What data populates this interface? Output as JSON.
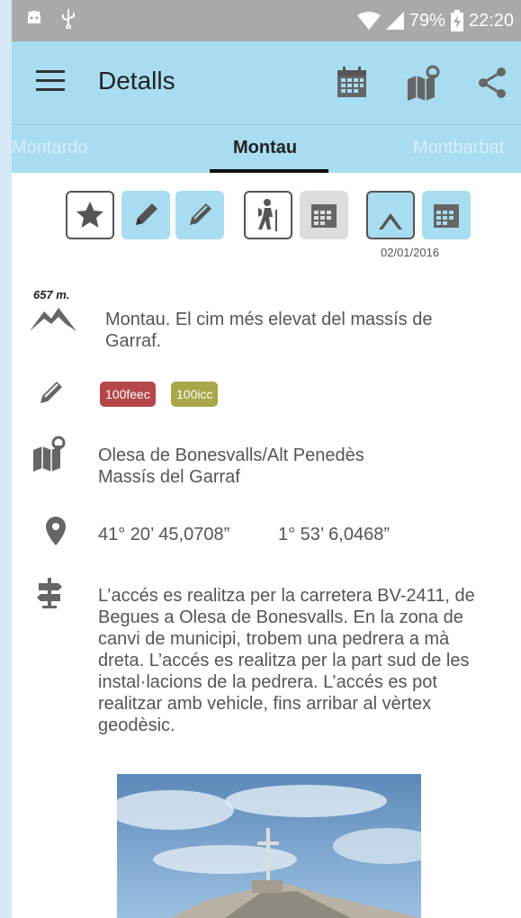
{
  "status_bar": {
    "left_icons": [
      "android-debug-icon",
      "usb-icon"
    ],
    "battery": "79%",
    "time": "22:20"
  },
  "app_bar": {
    "title": "Detalls",
    "actions": [
      "calendar-icon",
      "map-icon",
      "share-icon"
    ]
  },
  "tabs": {
    "previous": "Montardo",
    "current": "Montau",
    "next": "Montbarbat"
  },
  "toolbar": {
    "date": "02/01/2016"
  },
  "details": {
    "elevation": "657 m.",
    "description": "Montau. El cim més elevat del massís de Garraf.",
    "tags": [
      {
        "label": "100feec",
        "color": "#b5474b"
      },
      {
        "label": "100icc",
        "color": "#a8a74a"
      }
    ],
    "location_line1": "Olesa de Bonesvalls/Alt Penedès",
    "location_line2": "Massís del Garraf",
    "latitude": "41° 20’ 45,0708”",
    "longitude": "1° 53’ 6,0468”",
    "access": "L’accés es realitza per la carretera BV-2411, de Begues a Olesa de Bonesvalls. En la zona de canvi de municipi, trobem una pedrera a mà dreta. L’accés es realitza per la part sud de les instal·lacions de la pedrera. L’accés es pot realitzar amb vehicle, fins arribar al vèrtex geodèsic."
  },
  "colors": {
    "app_bar": "#a8dcf0",
    "status_bar": "#a9a9a9",
    "icon_grey": "#666666"
  }
}
